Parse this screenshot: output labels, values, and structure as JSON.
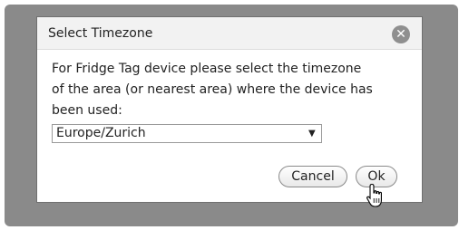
{
  "dialog": {
    "title": "Select Timezone",
    "close_icon": "close-icon",
    "message_line1": "For Fridge Tag device please select the timezone",
    "message_line2": "of the area (or nearest area) where the device has",
    "message_line3": "been used:",
    "timezone_selected": "Europe/Zurich",
    "cancel_label": "Cancel",
    "ok_label": "Ok"
  },
  "colors": {
    "overlay": "#8a8a8a",
    "titlebar": "#f2f2f2",
    "close_button": "#8f8f8f"
  }
}
